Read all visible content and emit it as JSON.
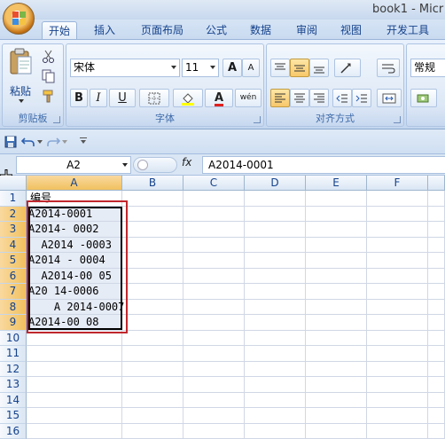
{
  "window": {
    "title": "book1 - Micr"
  },
  "tabs": [
    {
      "label": "开始",
      "active": true
    },
    {
      "label": "插入"
    },
    {
      "label": "页面布局"
    },
    {
      "label": "公式"
    },
    {
      "label": "数据"
    },
    {
      "label": "审阅"
    },
    {
      "label": "视图"
    },
    {
      "label": "开发工具"
    }
  ],
  "ribbon": {
    "clipboard": {
      "label": "剪贴板",
      "paste_label": "粘贴"
    },
    "font": {
      "label": "字体",
      "font_name": "宋体",
      "font_size": "11",
      "grow": "A",
      "shrink": "A",
      "bold": "B",
      "italic": "I",
      "underline": "U",
      "font_color_letter": "A",
      "phonetic": "wén"
    },
    "alignment": {
      "label": "对齐方式"
    },
    "number": {
      "format_value": "常规"
    }
  },
  "formula_bar": {
    "name_box": "A2",
    "fx": "fx",
    "value": "A2014-0001"
  },
  "sheet": {
    "columns": [
      "A",
      "B",
      "C",
      "D",
      "E",
      "F"
    ],
    "rows": [
      "1",
      "2",
      "3",
      "4",
      "5",
      "6",
      "7",
      "8",
      "9",
      "10",
      "11",
      "12",
      "13",
      "14",
      "15",
      "16"
    ],
    "column_a": [
      "编号",
      "A2014-0001",
      "A2014- 0002",
      "  A2014 -0003",
      "A2014 - 0004",
      "  A2014-00 05",
      "A20 14-0006",
      "    A 2014-0007",
      "A2014-00 08"
    ]
  },
  "colors": {
    "highlight_box": "#c0272d",
    "ribbon_bg": "#d5e3f5",
    "selection_header": "#f1c15f"
  }
}
